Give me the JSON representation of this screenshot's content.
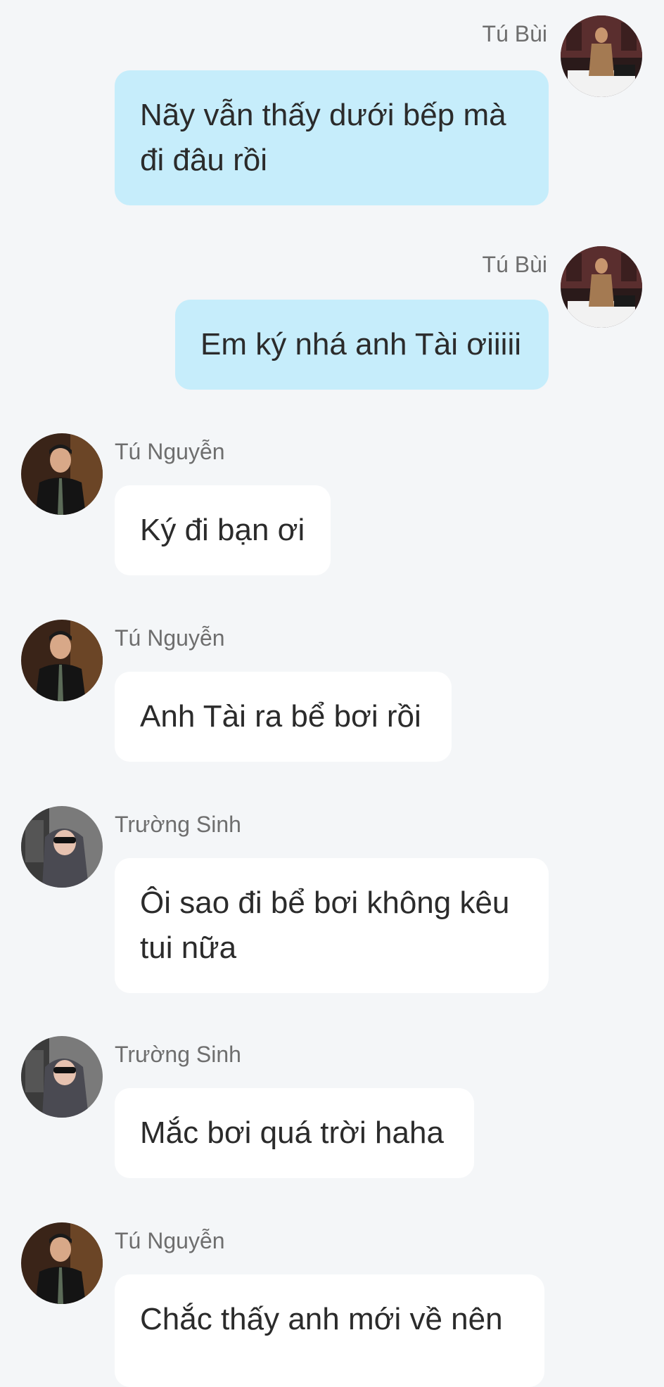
{
  "messages": [
    {
      "sender": "Tú Bùi",
      "text": "Nãy vẫn thấy dưới bếp mà đi đâu rồi",
      "direction": "outgoing",
      "avatar": "woman-in-brown-coat-avatar"
    },
    {
      "sender": "Tú Bùi",
      "text": "Em ký nhá anh Tài ơiiiii",
      "direction": "outgoing",
      "avatar": "woman-in-brown-coat-avatar"
    },
    {
      "sender": "Tú Nguyễn",
      "text": "Ký đi bạn ơi",
      "direction": "incoming",
      "avatar": "man-in-black-shirt-avatar"
    },
    {
      "sender": "Tú Nguyễn",
      "text": "Anh Tài ra bể bơi rồi",
      "direction": "incoming",
      "avatar": "man-in-black-shirt-avatar"
    },
    {
      "sender": "Trường Sinh",
      "text": "Ôi sao đi bể bơi không kêu tui nữa",
      "direction": "incoming",
      "avatar": "person-in-hood-sunglasses-avatar"
    },
    {
      "sender": "Trường Sinh",
      "text": "Mắc bơi quá trời haha",
      "direction": "incoming",
      "avatar": "person-in-hood-sunglasses-avatar"
    },
    {
      "sender": "Tú Nguyễn",
      "text": "Chắc thấy anh mới về nên",
      "direction": "incoming",
      "avatar": "man-in-black-shirt-avatar"
    }
  ],
  "colors": {
    "background": "#f4f6f8",
    "outgoing_bubble": "#c6edfb",
    "incoming_bubble": "#ffffff",
    "sender_name": "#6e6e6e",
    "message_text": "#2b2b2b"
  }
}
